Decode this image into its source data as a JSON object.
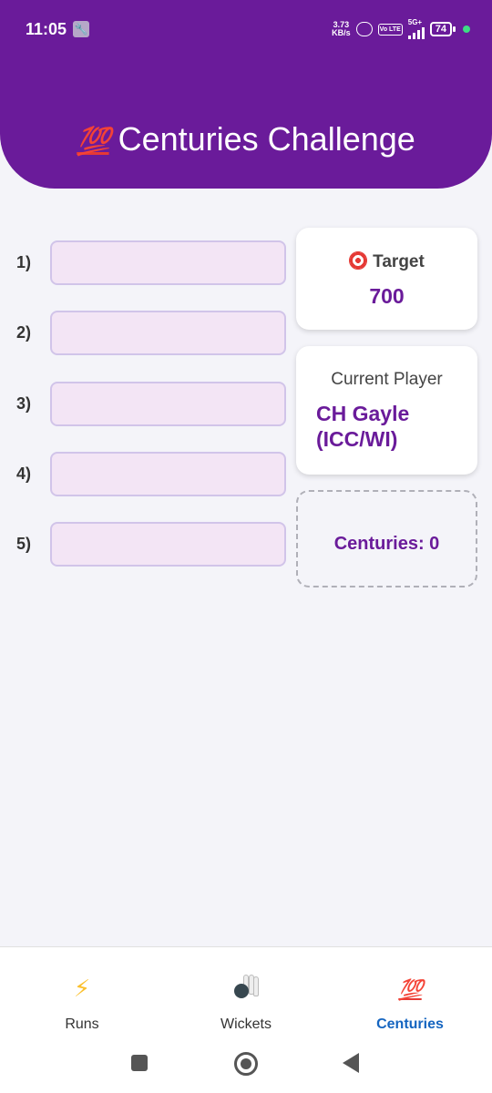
{
  "status_bar": {
    "time": "11:05",
    "speed_value": "3.73",
    "speed_unit": "KB/s",
    "volte": "Vo LTE",
    "network": "5G+",
    "battery": "74"
  },
  "header": {
    "emoji": "💯",
    "title": "Centuries Challenge",
    "color": "#6a1b9a"
  },
  "inputs": [
    {
      "label": "1)",
      "value": ""
    },
    {
      "label": "2)",
      "value": ""
    },
    {
      "label": "3)",
      "value": ""
    },
    {
      "label": "4)",
      "value": ""
    },
    {
      "label": "5)",
      "value": ""
    }
  ],
  "target_card": {
    "icon": "target-icon",
    "label": "Target",
    "value": "700"
  },
  "player_card": {
    "label": "Current Player",
    "name": "CH Gayle (ICC/WI)"
  },
  "centuries": {
    "text": "Centuries: 0"
  },
  "bottom_nav": {
    "items": [
      {
        "label": "Runs",
        "icon": "lightning-icon",
        "glyph": "⚡"
      },
      {
        "label": "Wickets",
        "icon": "bowling-icon"
      },
      {
        "label": "Centuries",
        "icon": "hundred-icon",
        "glyph": "💯",
        "active": true
      }
    ],
    "active_color": "#1565c0"
  }
}
